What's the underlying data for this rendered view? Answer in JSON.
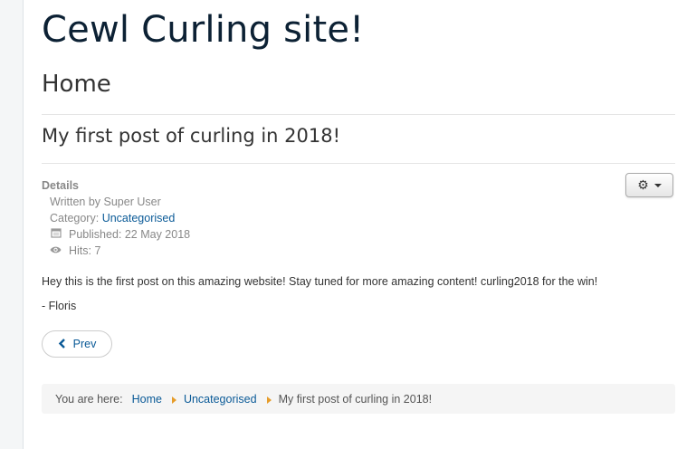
{
  "site": {
    "title": "Cewl Curling site!"
  },
  "page": {
    "heading": "Home"
  },
  "article": {
    "title": "My first post of curling in 2018!",
    "details_label": "Details",
    "written_by": "Written by Super User",
    "category_prefix": "Category: ",
    "category": "Uncategorised",
    "published": "Published: 22 May 2018",
    "hits": "Hits: 7",
    "body": "Hey this is the first post on this amazing website! Stay tuned for more amazing content! curling2018 for the win!",
    "signature": "- Floris",
    "tools_icon": "gear-icon"
  },
  "pagination": {
    "prev_label": "Prev"
  },
  "breadcrumb": {
    "prefix": "You are here:",
    "items": [
      "Home",
      "Uncategorised",
      "My first post of curling in 2018!"
    ],
    "separator_color": "#e69c2a"
  },
  "colors": {
    "link": "#0a5a97",
    "title": "#0c2134"
  }
}
